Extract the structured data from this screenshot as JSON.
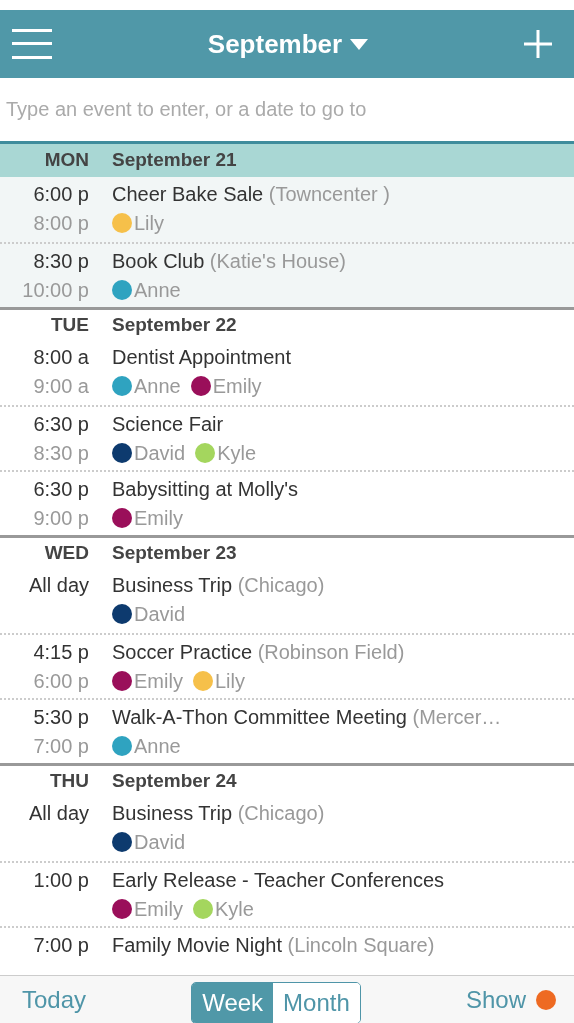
{
  "header": {
    "title": "September"
  },
  "search": {
    "placeholder": "Type an event to enter, or a date to go to"
  },
  "days": [
    {
      "weekday": "MON",
      "date": "September 21",
      "current": true,
      "events": [
        {
          "start": "6:00 p",
          "end": "8:00 p",
          "title": "Cheer Bake Sale",
          "location": "(Towncenter )",
          "people": [
            {
              "name": "Lily",
              "color": "#f6c04a"
            }
          ]
        },
        {
          "start": "8:30 p",
          "end": "10:00 p",
          "title": "Book Club",
          "location": "(Katie's House)",
          "people": [
            {
              "name": "Anne",
              "color": "#2fa3c0"
            }
          ]
        }
      ]
    },
    {
      "weekday": "TUE",
      "date": "September 22",
      "current": false,
      "events": [
        {
          "start": "8:00 a",
          "end": "9:00 a",
          "title": "Dentist Appointment",
          "people": [
            {
              "name": "Anne",
              "color": "#2fa3c0"
            },
            {
              "name": "Emily",
              "color": "#9a0f5a"
            }
          ]
        },
        {
          "start": "6:30 p",
          "end": "8:30 p",
          "title": "Science Fair",
          "people": [
            {
              "name": "David",
              "color": "#0d3a6e"
            },
            {
              "name": "Kyle",
              "color": "#a4d65e"
            }
          ]
        },
        {
          "start": "6:30 p",
          "end": "9:00 p",
          "title": "Babysitting at Molly's",
          "people": [
            {
              "name": "Emily",
              "color": "#9a0f5a"
            }
          ]
        }
      ]
    },
    {
      "weekday": "WED",
      "date": "September 23",
      "current": false,
      "events": [
        {
          "start": "All day",
          "title": "Business Trip",
          "location": "(Chicago)",
          "people": [
            {
              "name": "David",
              "color": "#0d3a6e"
            }
          ]
        },
        {
          "start": "4:15 p",
          "end": "6:00 p",
          "title": "Soccer Practice",
          "location": "(Robinson Field)",
          "people": [
            {
              "name": "Emily",
              "color": "#9a0f5a"
            },
            {
              "name": "Lily",
              "color": "#f6c04a"
            }
          ]
        },
        {
          "start": "5:30 p",
          "end": "7:00 p",
          "title": "Walk-A-Thon Committee Meeting",
          "location": "(Mercer…",
          "people": [
            {
              "name": "Anne",
              "color": "#2fa3c0"
            }
          ]
        }
      ]
    },
    {
      "weekday": "THU",
      "date": "September 24",
      "current": false,
      "events": [
        {
          "start": "All day",
          "title": "Business Trip",
          "location": "(Chicago)",
          "people": [
            {
              "name": "David",
              "color": "#0d3a6e"
            }
          ]
        },
        {
          "start": "1:00 p",
          "title": "Early Release - Teacher Conferences",
          "people": [
            {
              "name": "Emily",
              "color": "#9a0f5a"
            },
            {
              "name": "Kyle",
              "color": "#a4d65e"
            }
          ]
        },
        {
          "start": "7:00 p",
          "title": "Family Movie Night",
          "location": "(Lincoln Square)"
        }
      ]
    }
  ],
  "footer": {
    "today": "Today",
    "views": [
      {
        "label": "Week",
        "selected": true
      },
      {
        "label": "Month",
        "selected": false
      }
    ],
    "show": "Show"
  }
}
